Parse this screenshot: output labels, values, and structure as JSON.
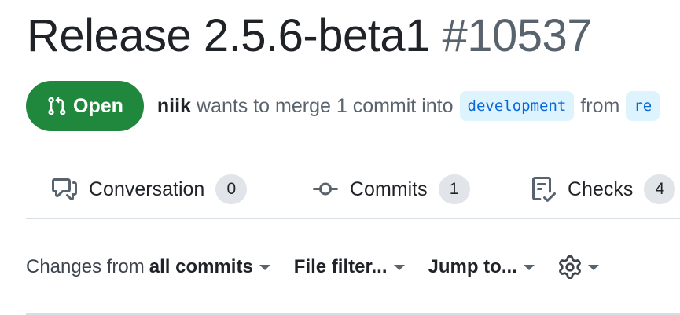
{
  "pr": {
    "title": "Release 2.5.6-beta1",
    "number": "#10537",
    "state_label": "Open",
    "author": "niik",
    "merge_text": "wants to merge 1 commit into",
    "base_branch": "development",
    "from_text": "from",
    "head_branch_partial": "re"
  },
  "tabs": [
    {
      "label": "Conversation",
      "count": "0",
      "icon": "comment-discussion-icon"
    },
    {
      "label": "Commits",
      "count": "1",
      "icon": "git-commit-icon"
    },
    {
      "label": "Checks",
      "count": "4",
      "icon": "checklist-icon"
    }
  ],
  "toolbar": {
    "changes_prefix": "Changes from",
    "changes_value": "all commits",
    "file_filter": "File filter...",
    "jump_to": "Jump to...",
    "settings_icon": "gear-icon"
  },
  "colors": {
    "open_green": "#1f883d",
    "branch_blue": "#0969da",
    "branch_bg": "#ddf4ff",
    "muted": "#59636e"
  }
}
